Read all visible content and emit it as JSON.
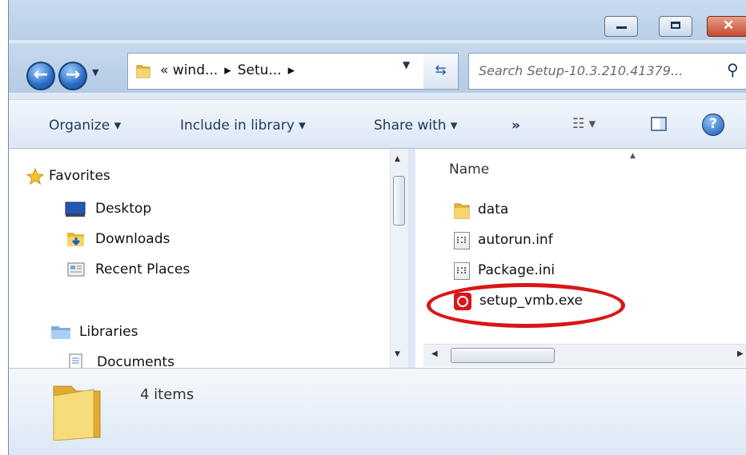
{
  "address": {
    "segments": [
      "« wind...",
      "▸",
      "Setu...",
      "▸"
    ]
  },
  "search": {
    "placeholder": "Search Setup-10.3.210.41379..."
  },
  "toolbar": {
    "organize": "Organize ▾",
    "include_in_library": "Include in library ▾",
    "share_with": "Share with ▾",
    "more": "»",
    "views": "☷ ▾"
  },
  "nav": {
    "favorites": "Favorites",
    "desktop": "Desktop",
    "downloads": "Downloads",
    "recent_places": "Recent Places",
    "libraries": "Libraries",
    "documents": "Documents"
  },
  "files": {
    "column_header": "Name",
    "items": [
      {
        "name": "data",
        "icon": "folder-icon"
      },
      {
        "name": "autorun.inf",
        "icon": "settings-file-icon"
      },
      {
        "name": "Package.ini",
        "icon": "settings-file-icon"
      },
      {
        "name": "setup_vmb.exe",
        "icon": "vodafone-app-icon"
      }
    ]
  },
  "details": {
    "count": "4 items"
  },
  "colors": {
    "highlight": "#d91616",
    "folder": "#f2c94c",
    "exe_red": "#d9151b"
  }
}
